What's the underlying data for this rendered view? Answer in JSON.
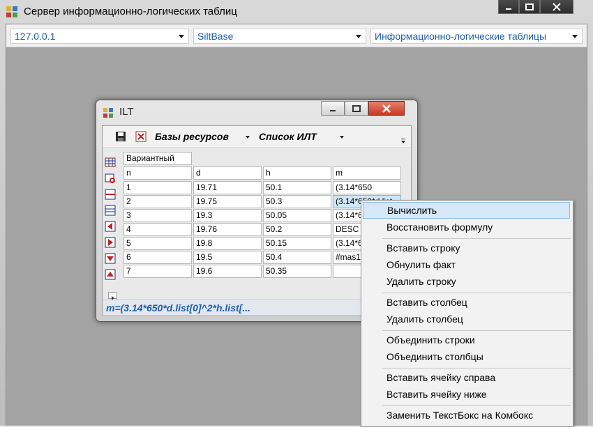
{
  "window": {
    "title": "Сервер информационно-логических таблиц"
  },
  "topbar": {
    "server": "127.0.0.1",
    "base": "SiltBase",
    "mode": "Информационно-логические таблицы"
  },
  "ilt": {
    "title": "ILT",
    "toolbar": {
      "resources_label": "Базы ресурсов",
      "list_label": "Список ИЛТ"
    },
    "variant_label": "Вариантный",
    "headers": [
      "n",
      "d",
      "h",
      "m"
    ],
    "rows": [
      [
        "1",
        "19.71",
        "50.1",
        "(3.14*650"
      ],
      [
        "2",
        "19.75",
        "50.3",
        "(3.14*650*d.list"
      ],
      [
        "3",
        "19.3",
        "50.05",
        "(3.14*6"
      ],
      [
        "4",
        "19.76",
        "50.2",
        "DESC"
      ],
      [
        "5",
        "19.8",
        "50.15",
        "(3.14*6"
      ],
      [
        "6",
        "19.5",
        "50.4",
        "#mas1"
      ],
      [
        "7",
        "19.6",
        "50.35",
        ""
      ]
    ],
    "formula": "m=(3.14*650*d.list[0]^2*h.list[..."
  },
  "context_menu": {
    "items": [
      "Вычислить",
      "Восстановить формулу",
      "Вставить строку",
      "Обнулить факт",
      "Удалить строку",
      "Вставить столбец",
      "Удалить столбец",
      "Объединить строки",
      "Объединить столбцы",
      "Вставить ячейку справа",
      "Вставить ячейку ниже",
      "Заменить ТекстБокс на Комбокс"
    ]
  }
}
